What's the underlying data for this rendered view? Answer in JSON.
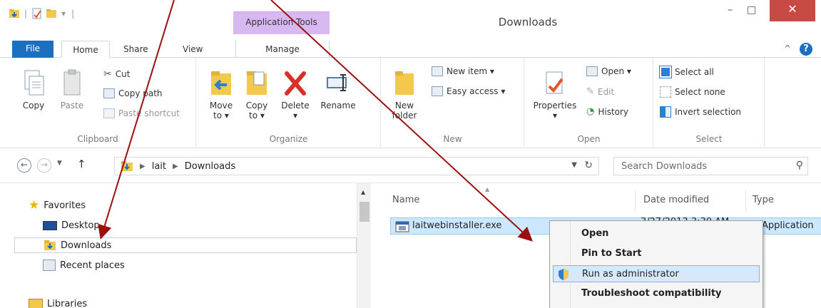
{
  "window": {
    "title": "Downloads",
    "contextual_tab_group": "Application Tools",
    "controls": {
      "minimize": "–",
      "maximize": "□",
      "close": "✕"
    }
  },
  "tabs": {
    "file": "File",
    "home": "Home",
    "share": "Share",
    "view": "View",
    "manage": "Manage",
    "collapse": "^",
    "help": "?"
  },
  "ribbon": {
    "clipboard": {
      "label": "Clipboard",
      "copy": "Copy",
      "paste": "Paste",
      "cut": "Cut",
      "copy_path": "Copy path",
      "paste_shortcut": "Paste shortcut"
    },
    "organize": {
      "label": "Organize",
      "move_to": "Move to ▾",
      "copy_to": "Copy to ▾",
      "delete": "Delete",
      "delete_arrow": "▾",
      "rename": "Rename"
    },
    "new": {
      "label": "New",
      "new_folder": "New folder",
      "new_item": "New item ▾",
      "easy_access": "Easy access ▾"
    },
    "open": {
      "label": "Open",
      "properties": "Properties",
      "properties_arrow": "▾",
      "open": "Open ▾",
      "edit": "Edit",
      "history": "History"
    },
    "select": {
      "label": "Select",
      "select_all": "Select all",
      "select_none": "Select none",
      "invert_selection": "Invert selection"
    }
  },
  "address": {
    "crumbs": [
      "lait",
      "Downloads"
    ],
    "search_placeholder": "Search Downloads"
  },
  "navpane": {
    "items": [
      {
        "label": "Favorites",
        "icon": "star-icon"
      },
      {
        "label": "Desktop",
        "icon": "desktop-icon"
      },
      {
        "label": "Downloads",
        "icon": "downloads-folder-icon"
      },
      {
        "label": "Recent places",
        "icon": "recent-places-icon"
      },
      {
        "label": "Libraries",
        "icon": "libraries-icon"
      }
    ]
  },
  "filelist": {
    "columns": {
      "name": "Name",
      "date": "Date modified",
      "type": "Type"
    },
    "rows": [
      {
        "name": "laitwebinstaller.exe",
        "date": "3/27/2013 3:30 AM",
        "type": "Application"
      }
    ]
  },
  "context_menu": {
    "items": [
      {
        "label": "Open",
        "bold": true
      },
      {
        "label": "Pin to Start",
        "bold": true
      },
      {
        "label": "Run as administrator",
        "bold": false,
        "highlighted": true
      },
      {
        "label": "Troubleshoot compatibility",
        "bold": true
      }
    ]
  },
  "colors": {
    "file_tab": "#1c6fbf",
    "contextual_tab": "#d7b8f0",
    "close_button": "#c94a44",
    "selection": "#cce8ff",
    "annotation_arrow": "#9b0f0f"
  }
}
